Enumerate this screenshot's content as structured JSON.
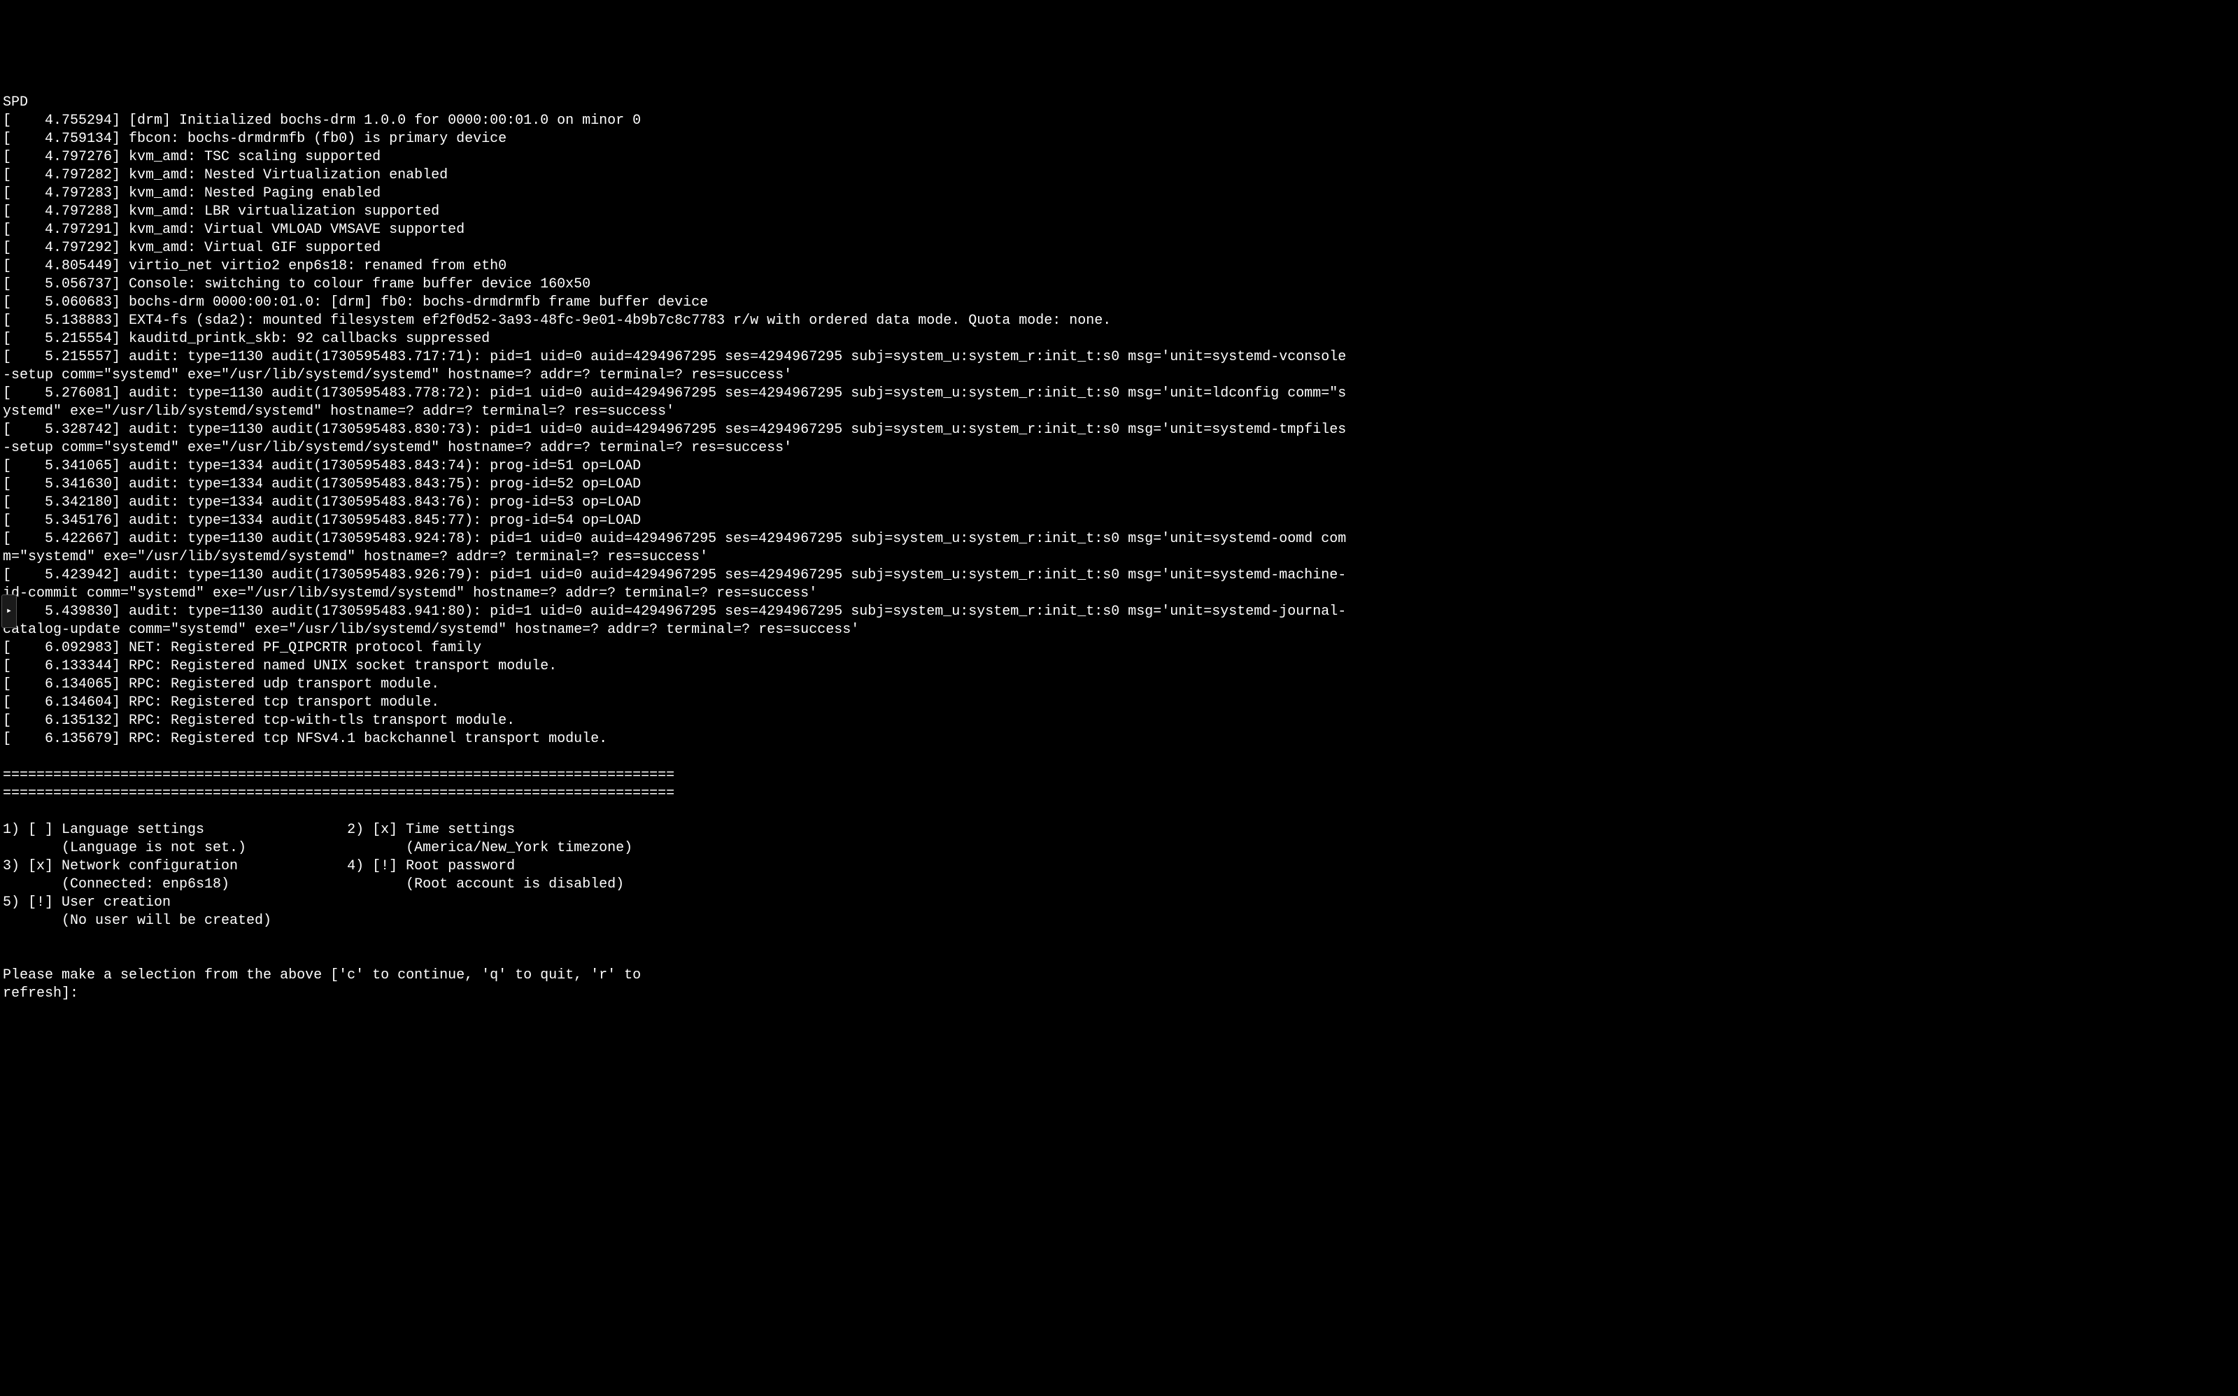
{
  "header_line": "SPD",
  "dmesg_lines": [
    "[    4.755294] [drm] Initialized bochs-drm 1.0.0 for 0000:00:01.0 on minor 0",
    "[    4.759134] fbcon: bochs-drmdrmfb (fb0) is primary device",
    "[    4.797276] kvm_amd: TSC scaling supported",
    "[    4.797282] kvm_amd: Nested Virtualization enabled",
    "[    4.797283] kvm_amd: Nested Paging enabled",
    "[    4.797288] kvm_amd: LBR virtualization supported",
    "[    4.797291] kvm_amd: Virtual VMLOAD VMSAVE supported",
    "[    4.797292] kvm_amd: Virtual GIF supported",
    "[    4.805449] virtio_net virtio2 enp6s18: renamed from eth0",
    "[    5.056737] Console: switching to colour frame buffer device 160x50",
    "[    5.060683] bochs-drm 0000:00:01.0: [drm] fb0: bochs-drmdrmfb frame buffer device",
    "[    5.138883] EXT4-fs (sda2): mounted filesystem ef2f0d52-3a93-48fc-9e01-4b9b7c8c7783 r/w with ordered data mode. Quota mode: none.",
    "[    5.215554] kauditd_printk_skb: 92 callbacks suppressed",
    "[    5.215557] audit: type=1130 audit(1730595483.717:71): pid=1 uid=0 auid=4294967295 ses=4294967295 subj=system_u:system_r:init_t:s0 msg='unit=systemd-vconsole",
    "-setup comm=\"systemd\" exe=\"/usr/lib/systemd/systemd\" hostname=? addr=? terminal=? res=success'",
    "[    5.276081] audit: type=1130 audit(1730595483.778:72): pid=1 uid=0 auid=4294967295 ses=4294967295 subj=system_u:system_r:init_t:s0 msg='unit=ldconfig comm=\"s",
    "ystemd\" exe=\"/usr/lib/systemd/systemd\" hostname=? addr=? terminal=? res=success'",
    "[    5.328742] audit: type=1130 audit(1730595483.830:73): pid=1 uid=0 auid=4294967295 ses=4294967295 subj=system_u:system_r:init_t:s0 msg='unit=systemd-tmpfiles",
    "-setup comm=\"systemd\" exe=\"/usr/lib/systemd/systemd\" hostname=? addr=? terminal=? res=success'",
    "[    5.341065] audit: type=1334 audit(1730595483.843:74): prog-id=51 op=LOAD",
    "[    5.341630] audit: type=1334 audit(1730595483.843:75): prog-id=52 op=LOAD",
    "[    5.342180] audit: type=1334 audit(1730595483.843:76): prog-id=53 op=LOAD",
    "[    5.345176] audit: type=1334 audit(1730595483.845:77): prog-id=54 op=LOAD",
    "[    5.422667] audit: type=1130 audit(1730595483.924:78): pid=1 uid=0 auid=4294967295 ses=4294967295 subj=system_u:system_r:init_t:s0 msg='unit=systemd-oomd com",
    "m=\"systemd\" exe=\"/usr/lib/systemd/systemd\" hostname=? addr=? terminal=? res=success'",
    "[    5.423942] audit: type=1130 audit(1730595483.926:79): pid=1 uid=0 auid=4294967295 ses=4294967295 subj=system_u:system_r:init_t:s0 msg='unit=systemd-machine-",
    "id-commit comm=\"systemd\" exe=\"/usr/lib/systemd/systemd\" hostname=? addr=? terminal=? res=success'",
    "[    5.439830] audit: type=1130 audit(1730595483.941:80): pid=1 uid=0 auid=4294967295 ses=4294967295 subj=system_u:system_r:init_t:s0 msg='unit=systemd-journal-",
    "catalog-update comm=\"systemd\" exe=\"/usr/lib/systemd/systemd\" hostname=? addr=? terminal=? res=success'",
    "[    6.092983] NET: Registered PF_QIPCRTR protocol family",
    "[    6.133344] RPC: Registered named UNIX socket transport module.",
    "[    6.134065] RPC: Registered udp transport module.",
    "[    6.134604] RPC: Registered tcp transport module.",
    "[    6.135132] RPC: Registered tcp-with-tls transport module.",
    "[    6.135679] RPC: Registered tcp NFSv4.1 backchannel transport module."
  ],
  "separator1": "================================================================================",
  "separator2": "================================================================================",
  "menu": {
    "item1": {
      "line1": "1) [ ] Language settings                 2) [x] Time settings",
      "line2": "       (Language is not set.)                   (America/New_York timezone)"
    },
    "item3": {
      "line1": "3) [x] Network configuration             4) [!] Root password",
      "line2": "       (Connected: enp6s18)                     (Root account is disabled)"
    },
    "item5": {
      "line1": "5) [!] User creation",
      "line2": "       (No user will be created)"
    }
  },
  "prompt": {
    "line1": "Please make a selection from the above ['c' to continue, 'q' to quit, 'r' to",
    "line2": "refresh]: "
  },
  "side_arrow": "▸"
}
